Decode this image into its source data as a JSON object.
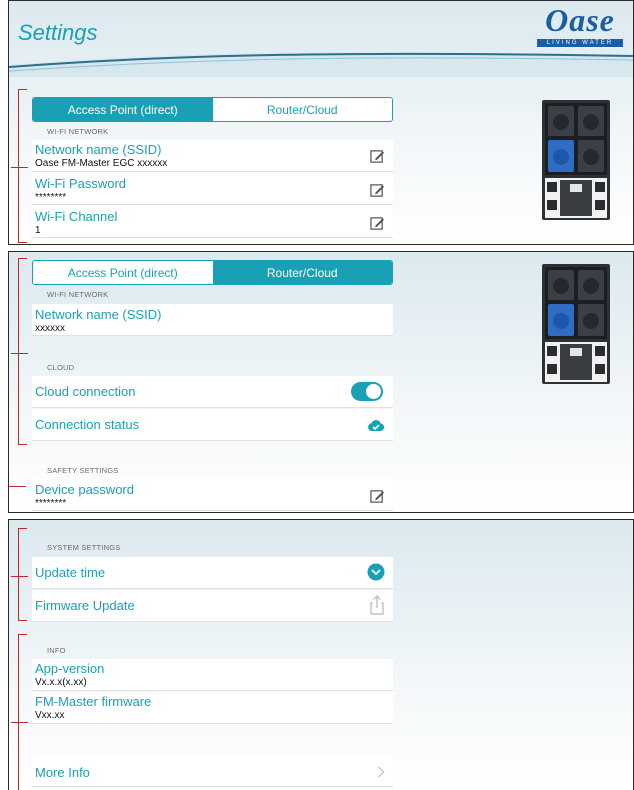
{
  "header": {
    "title": "Settings",
    "logo_text": "Oase",
    "logo_sub": "LIVING WATER"
  },
  "panel1": {
    "tabs": [
      {
        "label": "Access Point (direct)",
        "active": true
      },
      {
        "label": "Router/Cloud",
        "active": false
      }
    ],
    "section": "WI-FI NETWORK",
    "rows": [
      {
        "label": "Network name (SSID)",
        "value": "Oase FM-Master EGC xxxxxx",
        "icon": "edit-icon"
      },
      {
        "label": "Wi-Fi Password",
        "value": "********",
        "icon": "edit-icon"
      },
      {
        "label": "Wi-Fi Channel",
        "value": "1",
        "icon": "edit-icon"
      }
    ]
  },
  "panel2": {
    "tabs": [
      {
        "label": "Access Point (direct)",
        "active": false
      },
      {
        "label": "Router/Cloud",
        "active": true
      }
    ],
    "section_wifi": "WI-FI NETWORK",
    "network": {
      "label": "Network name (SSID)",
      "value": "xxxxxx"
    },
    "section_cloud": "CLOUD",
    "cloud_connection": {
      "label": "Cloud connection",
      "enabled": true
    },
    "connection_status": {
      "label": "Connection status",
      "icon": "cloud-check-icon"
    },
    "section_safety": "SAFETY SETTINGS",
    "device_password": {
      "label": "Device password",
      "value": "********",
      "icon": "edit-icon"
    }
  },
  "panel3": {
    "section_system": "SYSTEM SETTINGS",
    "update_time": {
      "label": "Update time",
      "icon": "chevron-down-circle-icon"
    },
    "firmware_update": {
      "label": "Firmware Update",
      "icon": "share-upload-icon"
    },
    "section_info": "INFO",
    "app_version": {
      "label": "App-version",
      "value": "Vx.x.x(x.xx)"
    },
    "fm_firmware": {
      "label": "FM-Master firmware",
      "value": "Vxx.xx"
    },
    "more_info": {
      "label": "More Info",
      "icon": "chevron-right-icon"
    }
  },
  "colors": {
    "accent": "#1aa0b4",
    "brand": "#1b5fa3",
    "annotation": "#c0262d"
  }
}
